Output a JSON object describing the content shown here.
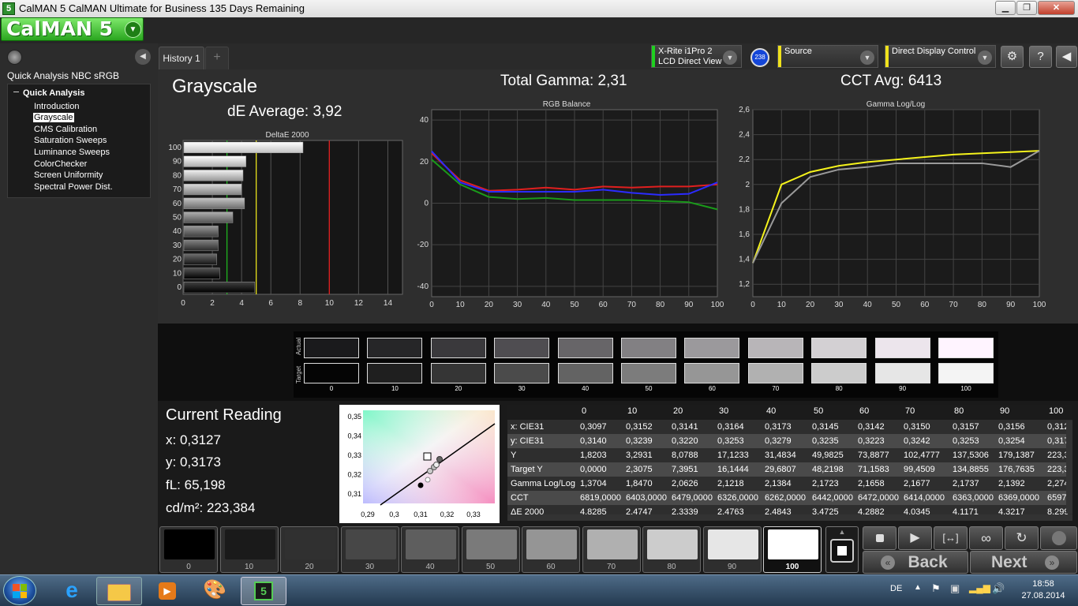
{
  "window": {
    "title": "CalMAN 5 CalMAN Ultimate for Business 135 Days Remaining"
  },
  "logo": {
    "text": "CalMAN 5"
  },
  "sidebar": {
    "workflow_title": "Quick Analysis NBC sRGB",
    "tree_head": "Quick Analysis",
    "items": [
      "Introduction",
      "Grayscale",
      "CMS Calibration",
      "Saturation Sweeps",
      "Luminance Sweeps",
      "ColorChecker",
      "Screen Uniformity",
      "Spectral Power Dist."
    ],
    "selected": "Grayscale"
  },
  "tabs": [
    {
      "label": "History 1"
    },
    {
      "label": "+"
    }
  ],
  "devices": {
    "meter_line1": "X-Rite i1Pro 2",
    "meter_line2": "LCD Direct View",
    "meter_badge": "238",
    "source": "Source",
    "display": "Direct Display Control"
  },
  "colors": {
    "meter": "#1fd11f",
    "source": "#f0e21c",
    "display": "#f0e21c"
  },
  "main": {
    "title": "Grayscale",
    "de_average": "dE Average: 3,92",
    "total_gamma": "Total Gamma: 2,31",
    "cct_avg": "CCT Avg: 6413"
  },
  "chart_data": [
    {
      "type": "bar",
      "title": "DeltaE 2000",
      "categories": [
        "100",
        "90",
        "80",
        "70",
        "60",
        "50",
        "40",
        "30",
        "20",
        "10",
        "0"
      ],
      "values": [
        8.2,
        4.3,
        4.1,
        4.0,
        4.2,
        3.4,
        2.4,
        2.4,
        2.3,
        2.5,
        4.9
      ],
      "xlim": [
        0,
        15
      ],
      "xticks": [
        "0",
        "2",
        "4",
        "6",
        "8",
        "10",
        "12",
        "14"
      ],
      "reference_lines": [
        {
          "x": 3,
          "color": "#1fb51f"
        },
        {
          "x": 5,
          "color": "#e8e21c"
        },
        {
          "x": 10,
          "color": "#e01f1f"
        }
      ]
    },
    {
      "type": "line",
      "title": "RGB Balance",
      "x": [
        0,
        10,
        20,
        30,
        40,
        50,
        60,
        70,
        80,
        90,
        100
      ],
      "ylim": [
        -45,
        45
      ],
      "yticks": [
        "40",
        "20",
        "0",
        "-20",
        "-40"
      ],
      "xticks": [
        "0",
        "10",
        "20",
        "30",
        "40",
        "50",
        "60",
        "70",
        "80",
        "90",
        "100"
      ],
      "series": [
        {
          "color": "#e01f1f",
          "values": [
            24,
            11,
            6,
            6.5,
            7.5,
            6.5,
            8,
            7.5,
            8,
            8,
            9
          ]
        },
        {
          "color": "#2b2bff",
          "values": [
            25,
            10,
            5.5,
            5.5,
            5.5,
            5.5,
            6.5,
            5,
            4,
            4.5,
            10
          ]
        },
        {
          "color": "#1a9a1a",
          "values": [
            21,
            9,
            3,
            2,
            2.5,
            1.5,
            1.5,
            1.5,
            1,
            0.5,
            -3
          ]
        }
      ]
    },
    {
      "type": "line",
      "title": "Gamma Log/Log",
      "x": [
        0,
        10,
        20,
        30,
        40,
        50,
        60,
        70,
        80,
        90,
        100
      ],
      "ylim": [
        1.1,
        2.6
      ],
      "yticks": [
        "2,6",
        "2,4",
        "2,2",
        "2",
        "1,8",
        "1,6",
        "1,4",
        "1,2"
      ],
      "xticks": [
        "0",
        "10",
        "20",
        "30",
        "40",
        "50",
        "60",
        "70",
        "80",
        "90",
        "100"
      ],
      "series": [
        {
          "color": "#f5f31c",
          "values": [
            1.37,
            2.0,
            2.1,
            2.15,
            2.18,
            2.2,
            2.22,
            2.24,
            2.25,
            2.26,
            2.27
          ]
        },
        {
          "color": "#9a9a9a",
          "values": [
            1.37,
            1.85,
            2.06,
            2.12,
            2.14,
            2.17,
            2.17,
            2.17,
            2.17,
            2.14,
            2.27
          ]
        }
      ]
    }
  ],
  "swatches": {
    "row_actual": "Actual",
    "row_target": "Target",
    "labels": [
      "0",
      "10",
      "20",
      "30",
      "40",
      "50",
      "60",
      "70",
      "80",
      "90",
      "100"
    ],
    "actual_colors": [
      "#1a1a1c",
      "#262628",
      "#3a393c",
      "#4f4d51",
      "#676568",
      "#828083",
      "#9b999c",
      "#b8b5b8",
      "#d3d0d3",
      "#ece5ec",
      "#fff4ff"
    ],
    "target_colors": [
      "#050505",
      "#1f1f1f",
      "#353535",
      "#4b4b4b",
      "#636363",
      "#7c7c7c",
      "#969696",
      "#b1b1b1",
      "#cccccc",
      "#e6e6e6",
      "#f4f4f4"
    ]
  },
  "current_reading": {
    "title": "Current Reading",
    "x": "x: 0,3127",
    "y": "y: 0,3173",
    "fl": "fL: 65,198",
    "cdm2": "cd/m²: 223,384"
  },
  "cie_plot": {
    "xticks": [
      "0,29",
      "0,3",
      "0,31",
      "0,32",
      "0,33"
    ],
    "yticks": [
      "0,35",
      "0,34",
      "0,33",
      "0,32",
      "0,31"
    ]
  },
  "table": {
    "headers": [
      "",
      "0",
      "10",
      "20",
      "30",
      "40",
      "50",
      "60",
      "70",
      "80",
      "90",
      "100"
    ],
    "rows": [
      {
        "label": "x: CIE31",
        "values": [
          "0,3097",
          "0,3152",
          "0,3141",
          "0,3164",
          "0,3173",
          "0,3145",
          "0,3142",
          "0,3150",
          "0,3157",
          "0,3156",
          "0,312"
        ]
      },
      {
        "label": "y: CIE31",
        "values": [
          "0,3140",
          "0,3239",
          "0,3220",
          "0,3253",
          "0,3279",
          "0,3235",
          "0,3223",
          "0,3242",
          "0,3253",
          "0,3254",
          "0,317"
        ]
      },
      {
        "label": "Y",
        "values": [
          "1,8203",
          "3,2931",
          "8,0788",
          "17,1233",
          "31,4834",
          "49,9825",
          "73,8877",
          "102,4777",
          "137,5306",
          "179,1387",
          "223,3"
        ]
      },
      {
        "label": "Target Y",
        "values": [
          "0,0000",
          "2,3075",
          "7,3951",
          "16,1444",
          "29,6807",
          "48,2198",
          "71,1583",
          "99,4509",
          "134,8855",
          "176,7635",
          "223,3"
        ]
      },
      {
        "label": "Gamma Log/Log",
        "values": [
          "1,3704",
          "1,8470",
          "2,0626",
          "2,1218",
          "2,1384",
          "2,1723",
          "2,1658",
          "2,1677",
          "2,1737",
          "2,1392",
          "2,274"
        ]
      },
      {
        "label": "CCT",
        "values": [
          "6819,0000",
          "6403,0000",
          "6479,0000",
          "6326,0000",
          "6262,0000",
          "6442,0000",
          "6472,0000",
          "6414,0000",
          "6363,0000",
          "6369,0000",
          "6597,"
        ]
      },
      {
        "label": "ΔE 2000",
        "values": [
          "4,8285",
          "2,4747",
          "2,3339",
          "2,4763",
          "2,4843",
          "3,4725",
          "4,2882",
          "4,0345",
          "4,1171",
          "4,3217",
          "8,299"
        ]
      }
    ]
  },
  "bottom_swatches": {
    "labels": [
      "0",
      "10",
      "20",
      "30",
      "40",
      "50",
      "60",
      "70",
      "80",
      "90",
      "100"
    ],
    "colors": [
      "#000000",
      "#1a1a1a",
      "#303030",
      "#474747",
      "#5e5e5e",
      "#7a7a7a",
      "#959595",
      "#b0b0b0",
      "#cccccc",
      "#e6e6e6",
      "#ffffff"
    ],
    "selected": "100"
  },
  "nav": {
    "back": "Back",
    "next": "Next"
  },
  "taskbar": {
    "lang": "DE",
    "time": "18:58",
    "date": "27.08.2014"
  }
}
